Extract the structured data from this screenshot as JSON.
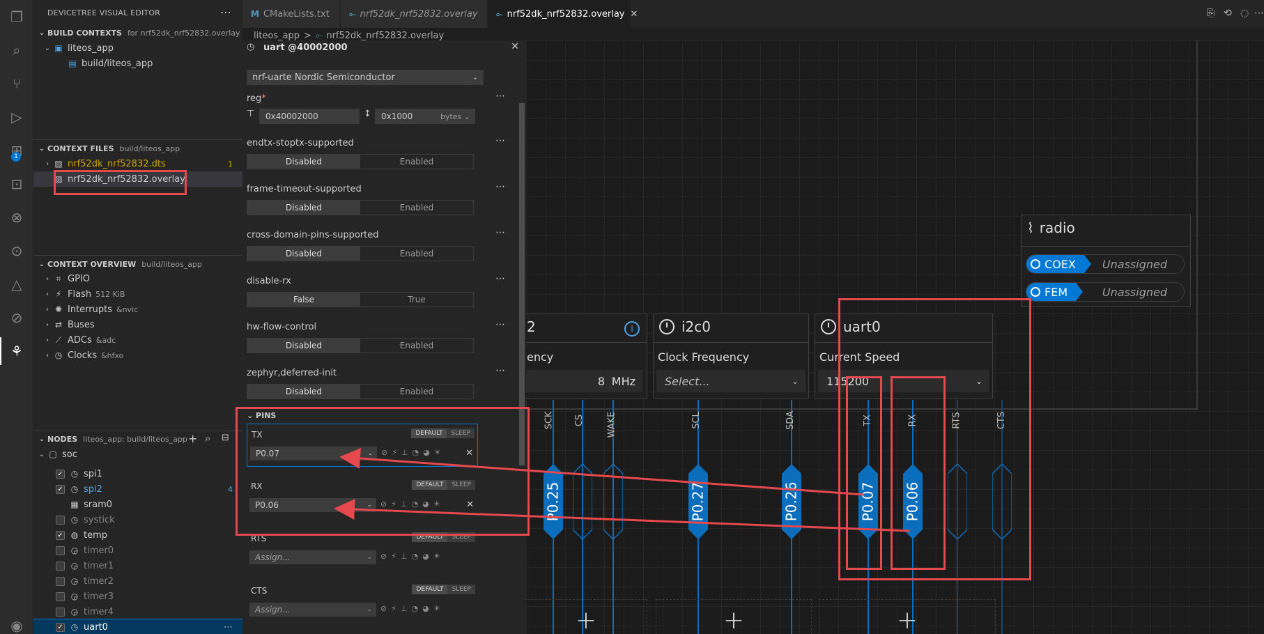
{
  "sidebar": {
    "header": "DEVICETREE VISUAL EDITOR",
    "build_contexts": {
      "title": "BUILD CONTEXTS",
      "sub": "for nrf52dk_nrf52832.overlay",
      "app": "liteos_app",
      "build": "build/liteos_app"
    },
    "context_files": {
      "title": "CONTEXT FILES",
      "sub": "build/liteos_app",
      "dts": "nrf52dk_nrf52832.dts",
      "dts_count": "1",
      "overlay": "nrf52dk_nrf52832.overlay"
    },
    "overview": {
      "title": "CONTEXT OVERVIEW",
      "sub": "build/liteos_app",
      "items": [
        {
          "label": "GPIO",
          "meta": ""
        },
        {
          "label": "Flash",
          "meta": "512 KiB"
        },
        {
          "label": "Interrupts",
          "meta": "&nvic"
        },
        {
          "label": "Buses",
          "meta": ""
        },
        {
          "label": "ADCs",
          "meta": "&adc"
        },
        {
          "label": "Clocks",
          "meta": "&hfxo"
        }
      ]
    },
    "nodes": {
      "title": "NODES",
      "sub": "liteos_app: build/liteos_app",
      "root": "soc",
      "items": [
        {
          "label": "spi1",
          "checked": true
        },
        {
          "label": "spi2",
          "checked": true,
          "count": "4"
        },
        {
          "label": "sram0",
          "checked": false
        },
        {
          "label": "systick",
          "checked": false
        },
        {
          "label": "temp",
          "checked": true
        },
        {
          "label": "timer0",
          "checked": false
        },
        {
          "label": "timer1",
          "checked": false
        },
        {
          "label": "timer2",
          "checked": false
        },
        {
          "label": "timer3",
          "checked": false
        },
        {
          "label": "timer4",
          "checked": false
        },
        {
          "label": "uart0",
          "checked": true
        }
      ]
    }
  },
  "tabs": [
    {
      "icon": "M",
      "label": "CMakeLists.txt"
    },
    {
      "icon": "overlay",
      "label": "nrf52dk_nrf52832.overlay"
    },
    {
      "icon": "overlay",
      "label": "nrf52dk_nrf52832.overlay"
    }
  ],
  "breadcrumb": {
    "folder": "liteos_app",
    "sep": ">",
    "file": "nrf52dk_nrf52832.overlay"
  },
  "props": {
    "title": "uart @40002000",
    "compatible": "nrf-uarte Nordic Semiconductor",
    "reg_label": "reg",
    "reg_required": "*",
    "reg_addr": "0x40002000",
    "reg_size": "0x1000",
    "reg_unit": "bytes",
    "bools": [
      {
        "label": "endtx-stoptx-supported",
        "off": "Disabled",
        "on": "Enabled"
      },
      {
        "label": "frame-timeout-supported",
        "off": "Disabled",
        "on": "Enabled"
      },
      {
        "label": "cross-domain-pins-supported",
        "off": "Disabled",
        "on": "Enabled"
      },
      {
        "label": "disable-rx",
        "off": "False",
        "on": "True"
      },
      {
        "label": "hw-flow-control",
        "off": "Disabled",
        "on": "Enabled"
      },
      {
        "label": "zephyr,deferred-init",
        "off": "Disabled",
        "on": "Enabled"
      }
    ],
    "pins_title": "PINS",
    "pin_tab_default": "DEFAULT",
    "pin_tab_sleep": "SLEEP",
    "pins": [
      {
        "name": "TX",
        "value": "P0.07"
      },
      {
        "name": "RX",
        "value": "P0.06"
      },
      {
        "name": "RTS",
        "placeholder": "Assign..."
      },
      {
        "name": "CTS",
        "placeholder": "Assign..."
      }
    ]
  },
  "canvas": {
    "spi_card": {
      "title": "2",
      "sub": "ency",
      "value": "8",
      "unit": "MHz",
      "pins": [
        "SCK",
        "CS",
        "WAKE"
      ],
      "hex": "P0.25"
    },
    "i2c_card": {
      "title": "i2c0",
      "sub": "Clock Frequency",
      "placeholder": "Select...",
      "pins": [
        "SCL",
        "SDA"
      ],
      "hex": [
        "P0.27",
        "P0.26"
      ]
    },
    "uart_card": {
      "title": "uart0",
      "sub": "Current Speed",
      "value": "115200",
      "pins": [
        "TX",
        "RX",
        "RTS",
        "CTS"
      ],
      "hex": [
        "P0.07",
        "P0.06"
      ]
    },
    "radio_card": {
      "title": "radio",
      "chips": [
        {
          "tag": "COEX",
          "value": "Unassigned"
        },
        {
          "tag": "FEM",
          "value": "Unassigned"
        }
      ]
    },
    "add_symbol": "+"
  },
  "colors": {
    "accent": "#0078d4",
    "pin_blue": "#0b6ebd",
    "annotation_red": "#e5484d"
  }
}
